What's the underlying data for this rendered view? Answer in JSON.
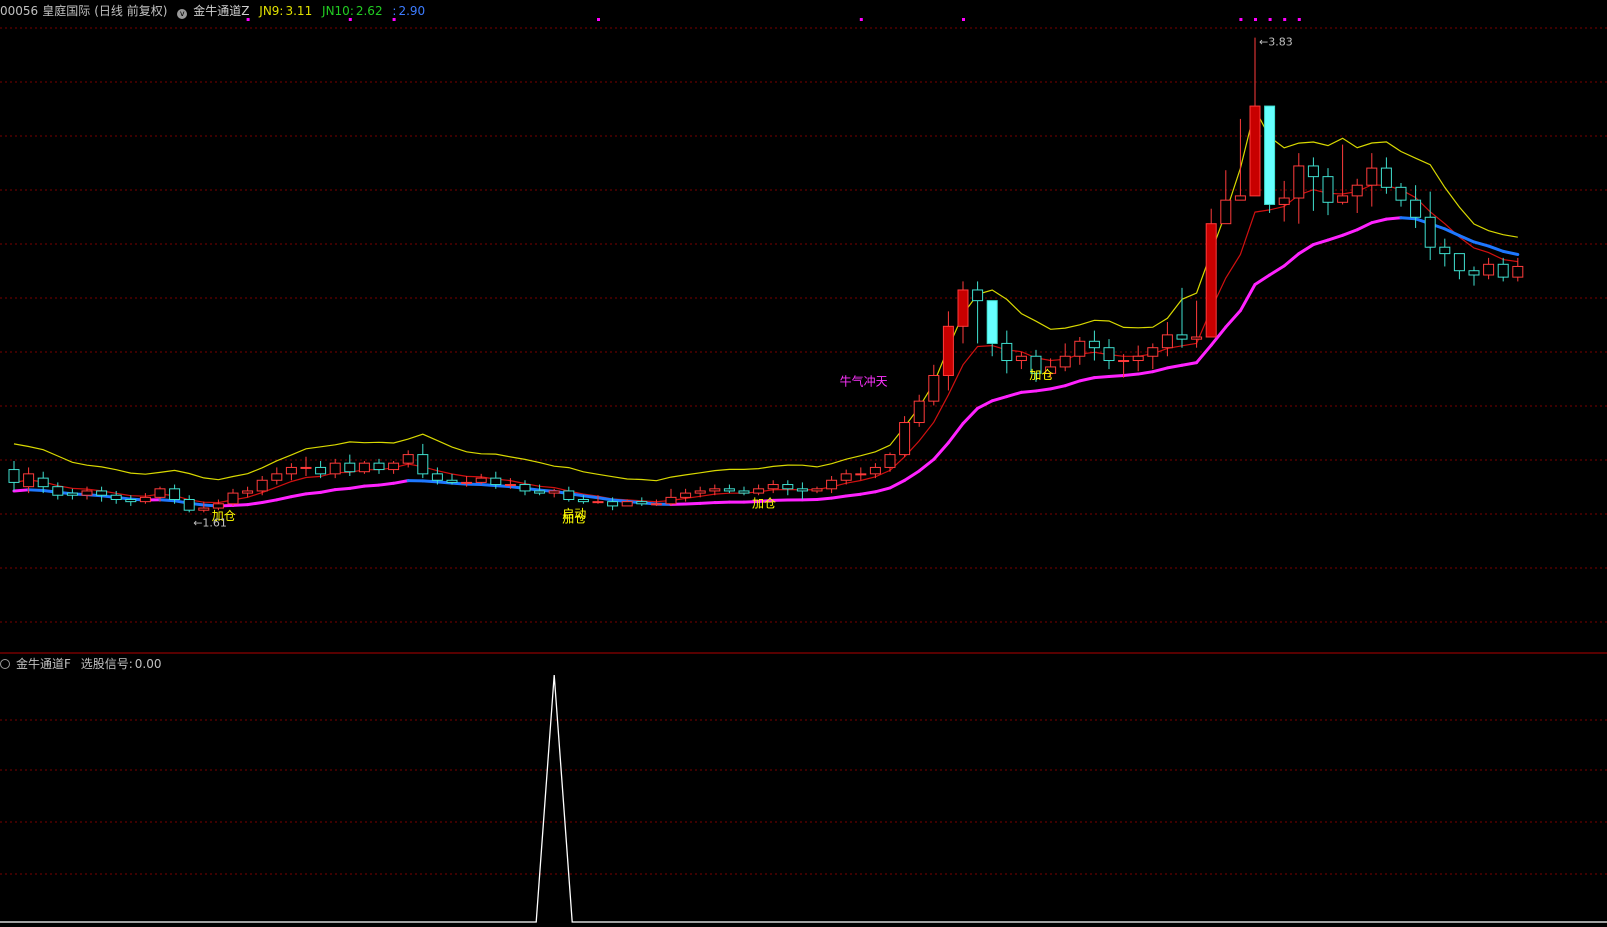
{
  "main_panel": {
    "stock_code": "00056",
    "stock_name": "皇庭国际",
    "period": "(日线 前复权)",
    "indicator_name": "金牛通道Z",
    "jn9_label": "JN9:",
    "jn9_value": "3.11",
    "jn10_label": "JN10:",
    "jn10_value": "2.62",
    "jn11_label": ":",
    "jn11_value": "2.90"
  },
  "sub_panel": {
    "indicator_name": "金牛通道F",
    "signal_label": "选股信号:",
    "signal_value": "0.00"
  },
  "colors": {
    "background": "#000000",
    "grid": "#7a0000",
    "separator": "#b00000",
    "up_candle": "#ff3b3b",
    "up_candle_fill": "#c80000",
    "down_candle": "#40e0d0",
    "down_candle_fill": "#66ffff",
    "upper_band": "#d8d800",
    "mid_band_up": "#d01010",
    "mid_band_down": "#20c020",
    "lower_band_up": "#ff22ff",
    "lower_band_down": "#1e78ff",
    "signal_line": "#ffffff",
    "jn9": "#e0e000",
    "jn10": "#22cc22",
    "jn11": "#3d7cff",
    "annotation": "#ffff00",
    "annotation_special": "#ff33ff",
    "dots": "#ff00ff"
  },
  "chart_data": [
    {
      "type": "candlestick",
      "series_names": [
        "JN9",
        "JN10",
        ""
      ],
      "ylim": [
        1.2,
        3.95
      ],
      "candles": [
        [
          1.81,
          1.75,
          1.85,
          1.71
        ],
        [
          1.73,
          1.79,
          1.82,
          1.7
        ],
        [
          1.77,
          1.73,
          1.8,
          1.7
        ],
        [
          1.73,
          1.69,
          1.75,
          1.67
        ],
        [
          1.7,
          1.69,
          1.72,
          1.67
        ],
        [
          1.69,
          1.71,
          1.73,
          1.67
        ],
        [
          1.71,
          1.69,
          1.73,
          1.66
        ],
        [
          1.69,
          1.67,
          1.71,
          1.65
        ],
        [
          1.67,
          1.66,
          1.69,
          1.64
        ],
        [
          1.66,
          1.68,
          1.7,
          1.65
        ],
        [
          1.68,
          1.72,
          1.73,
          1.66
        ],
        [
          1.72,
          1.67,
          1.74,
          1.65
        ],
        [
          1.67,
          1.62,
          1.69,
          1.61
        ],
        [
          1.62,
          1.63,
          1.66,
          1.61
        ],
        [
          1.63,
          1.65,
          1.67,
          1.62
        ],
        [
          1.65,
          1.7,
          1.72,
          1.64
        ],
        [
          1.7,
          1.71,
          1.73,
          1.68
        ],
        [
          1.71,
          1.76,
          1.78,
          1.69
        ],
        [
          1.76,
          1.79,
          1.82,
          1.74
        ],
        [
          1.79,
          1.82,
          1.84,
          1.76
        ],
        [
          1.82,
          1.82,
          1.87,
          1.78
        ],
        [
          1.82,
          1.79,
          1.85,
          1.77
        ],
        [
          1.79,
          1.84,
          1.86,
          1.77
        ],
        [
          1.84,
          1.8,
          1.88,
          1.78
        ],
        [
          1.8,
          1.84,
          1.85,
          1.79
        ],
        [
          1.84,
          1.81,
          1.86,
          1.79
        ],
        [
          1.81,
          1.84,
          1.85,
          1.79
        ],
        [
          1.84,
          1.88,
          1.9,
          1.82
        ],
        [
          1.88,
          1.79,
          1.93,
          1.77
        ],
        [
          1.79,
          1.76,
          1.82,
          1.74
        ],
        [
          1.76,
          1.75,
          1.79,
          1.74
        ],
        [
          1.75,
          1.75,
          1.78,
          1.73
        ],
        [
          1.75,
          1.77,
          1.79,
          1.74
        ],
        [
          1.77,
          1.74,
          1.8,
          1.72
        ],
        [
          1.74,
          1.74,
          1.77,
          1.72
        ],
        [
          1.74,
          1.71,
          1.76,
          1.69
        ],
        [
          1.71,
          1.7,
          1.74,
          1.69
        ],
        [
          1.7,
          1.71,
          1.72,
          1.68
        ],
        [
          1.71,
          1.67,
          1.73,
          1.66
        ],
        [
          1.67,
          1.66,
          1.69,
          1.65
        ],
        [
          1.66,
          1.66,
          1.69,
          1.65
        ],
        [
          1.66,
          1.64,
          1.68,
          1.62
        ],
        [
          1.64,
          1.66,
          1.67,
          1.64
        ],
        [
          1.66,
          1.65,
          1.68,
          1.64
        ],
        [
          1.65,
          1.65,
          1.67,
          1.64
        ],
        [
          1.65,
          1.68,
          1.72,
          1.64
        ],
        [
          1.68,
          1.7,
          1.72,
          1.66
        ],
        [
          1.7,
          1.71,
          1.73,
          1.68
        ],
        [
          1.71,
          1.72,
          1.74,
          1.69
        ],
        [
          1.72,
          1.71,
          1.74,
          1.7
        ],
        [
          1.71,
          1.7,
          1.73,
          1.69
        ],
        [
          1.7,
          1.72,
          1.74,
          1.69
        ],
        [
          1.72,
          1.74,
          1.76,
          1.7
        ],
        [
          1.74,
          1.72,
          1.76,
          1.69
        ],
        [
          1.72,
          1.71,
          1.75,
          1.67
        ],
        [
          1.71,
          1.72,
          1.73,
          1.7
        ],
        [
          1.72,
          1.76,
          1.78,
          1.7
        ],
        [
          1.76,
          1.79,
          1.81,
          1.74
        ],
        [
          1.79,
          1.79,
          1.82,
          1.76
        ],
        [
          1.79,
          1.82,
          1.84,
          1.77
        ],
        [
          1.82,
          1.88,
          1.89,
          1.8
        ],
        [
          1.88,
          2.03,
          2.06,
          1.87
        ],
        [
          2.03,
          2.13,
          2.16,
          2.01
        ],
        [
          2.13,
          2.25,
          2.3,
          2.11
        ],
        [
          2.25,
          2.48,
          2.55,
          2.18
        ],
        [
          2.48,
          2.65,
          2.69,
          2.4
        ],
        [
          2.65,
          2.6,
          2.69,
          2.4
        ],
        [
          2.6,
          2.4,
          2.6,
          2.34
        ],
        [
          2.4,
          2.32,
          2.46,
          2.26
        ],
        [
          2.32,
          2.34,
          2.36,
          2.28
        ],
        [
          2.34,
          2.26,
          2.37,
          2.22
        ],
        [
          2.26,
          2.29,
          2.33,
          2.24
        ],
        [
          2.29,
          2.34,
          2.4,
          2.27
        ],
        [
          2.34,
          2.41,
          2.43,
          2.3
        ],
        [
          2.41,
          2.38,
          2.46,
          2.32
        ],
        [
          2.38,
          2.32,
          2.42,
          2.28
        ],
        [
          2.32,
          2.32,
          2.35,
          2.24
        ],
        [
          2.32,
          2.34,
          2.39,
          2.27
        ],
        [
          2.34,
          2.38,
          2.4,
          2.28
        ],
        [
          2.38,
          2.44,
          2.5,
          2.34
        ],
        [
          2.44,
          2.42,
          2.66,
          2.38
        ],
        [
          2.42,
          2.43,
          2.6,
          2.38
        ],
        [
          2.43,
          2.96,
          3.03,
          2.91
        ],
        [
          2.96,
          3.07,
          3.21,
          2.96
        ],
        [
          3.07,
          3.09,
          3.45,
          3.07
        ],
        [
          3.09,
          3.51,
          3.83,
          3.2
        ],
        [
          3.51,
          3.05,
          3.09,
          3.01
        ],
        [
          3.05,
          3.08,
          3.16,
          2.97
        ],
        [
          3.08,
          3.23,
          3.29,
          2.96
        ],
        [
          3.23,
          3.18,
          3.27,
          3.02
        ],
        [
          3.18,
          3.06,
          3.22,
          3.0
        ],
        [
          3.06,
          3.09,
          3.33,
          3.05
        ],
        [
          3.09,
          3.14,
          3.17,
          3.01
        ],
        [
          3.14,
          3.22,
          3.29,
          3.04
        ],
        [
          3.22,
          3.13,
          3.27,
          3.1
        ],
        [
          3.13,
          3.07,
          3.15,
          3.04
        ],
        [
          3.07,
          2.99,
          3.14,
          2.94
        ],
        [
          2.99,
          2.85,
          3.11,
          2.79
        ],
        [
          2.85,
          2.82,
          2.89,
          2.76
        ],
        [
          2.82,
          2.74,
          2.82,
          2.7
        ],
        [
          2.74,
          2.72,
          2.76,
          2.67
        ],
        [
          2.72,
          2.77,
          2.8,
          2.7
        ],
        [
          2.77,
          2.71,
          2.8,
          2.69
        ],
        [
          2.71,
          2.76,
          2.8,
          2.69
        ]
      ],
      "marked_low": "1.61",
      "marked_high": "3.83",
      "annotations": [
        {
          "index": 13,
          "text": "加仓",
          "price": 1.62
        },
        {
          "index": 37,
          "text": "启动",
          "price": 1.63
        },
        {
          "index": 37,
          "text": "加仓",
          "price": 1.61
        },
        {
          "index": 50,
          "text": "加仓",
          "price": 1.68
        },
        {
          "index": 56,
          "text": "牛气冲天",
          "price": 2.25
        },
        {
          "index": 69,
          "text": "加仓",
          "price": 2.28
        }
      ]
    },
    {
      "type": "line",
      "series": [
        {
          "name": "选股信号",
          "values_note": "single spike at candle 37 reaching 1, else 0",
          "spike_index": 37,
          "spike_value": 1
        }
      ],
      "ylim": [
        0,
        1
      ]
    }
  ]
}
